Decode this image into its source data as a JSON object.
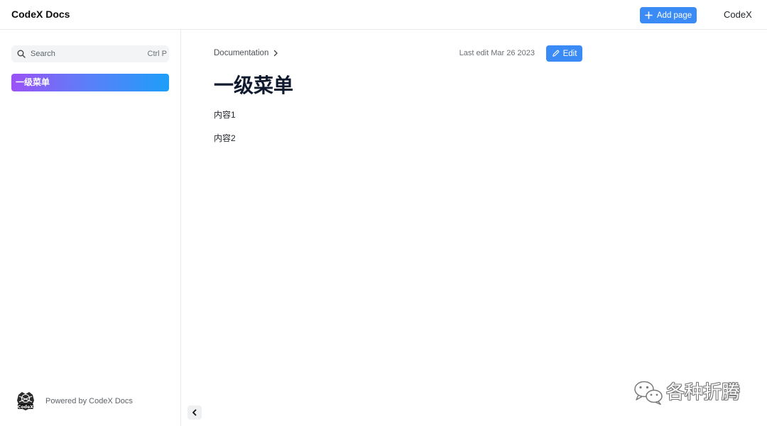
{
  "app": {
    "title": "CodeX Docs"
  },
  "header": {
    "add_page_label": "Add page",
    "user_label": "CodeX"
  },
  "sidebar": {
    "search": {
      "label": "Search",
      "shortcut": "Ctrl P"
    },
    "items": [
      {
        "label": "一级菜单",
        "active": true
      }
    ],
    "footer": {
      "logo_text": "CodeX",
      "powered_by": "Powered by CodeX Docs"
    }
  },
  "main": {
    "breadcrumb": [
      "Documentation"
    ],
    "last_edit": "Last edit Mar 26 2023",
    "edit_label": "Edit",
    "page": {
      "title": "一级菜单",
      "paragraphs": [
        "内容1",
        "内容2"
      ]
    }
  },
  "watermark": {
    "text": "各种折腾"
  },
  "icons": {
    "add_page": "plus-icon",
    "search": "search-icon",
    "edit": "pencil-icon",
    "breadcrumb_separator": "chevron-right-icon",
    "sidebar_collapse": "chevron-left-icon",
    "footer_logo": "codex-logo-icon",
    "watermark": "wechat-icon"
  },
  "colors": {
    "accent": "#3a8bf5",
    "active_item_gradient_start": "#9b52f6",
    "active_item_gradient_end": "#1d9ef8",
    "title_text": "#0f1a2e",
    "border": "#e9eaed",
    "search_background": "#f2f4f6"
  }
}
